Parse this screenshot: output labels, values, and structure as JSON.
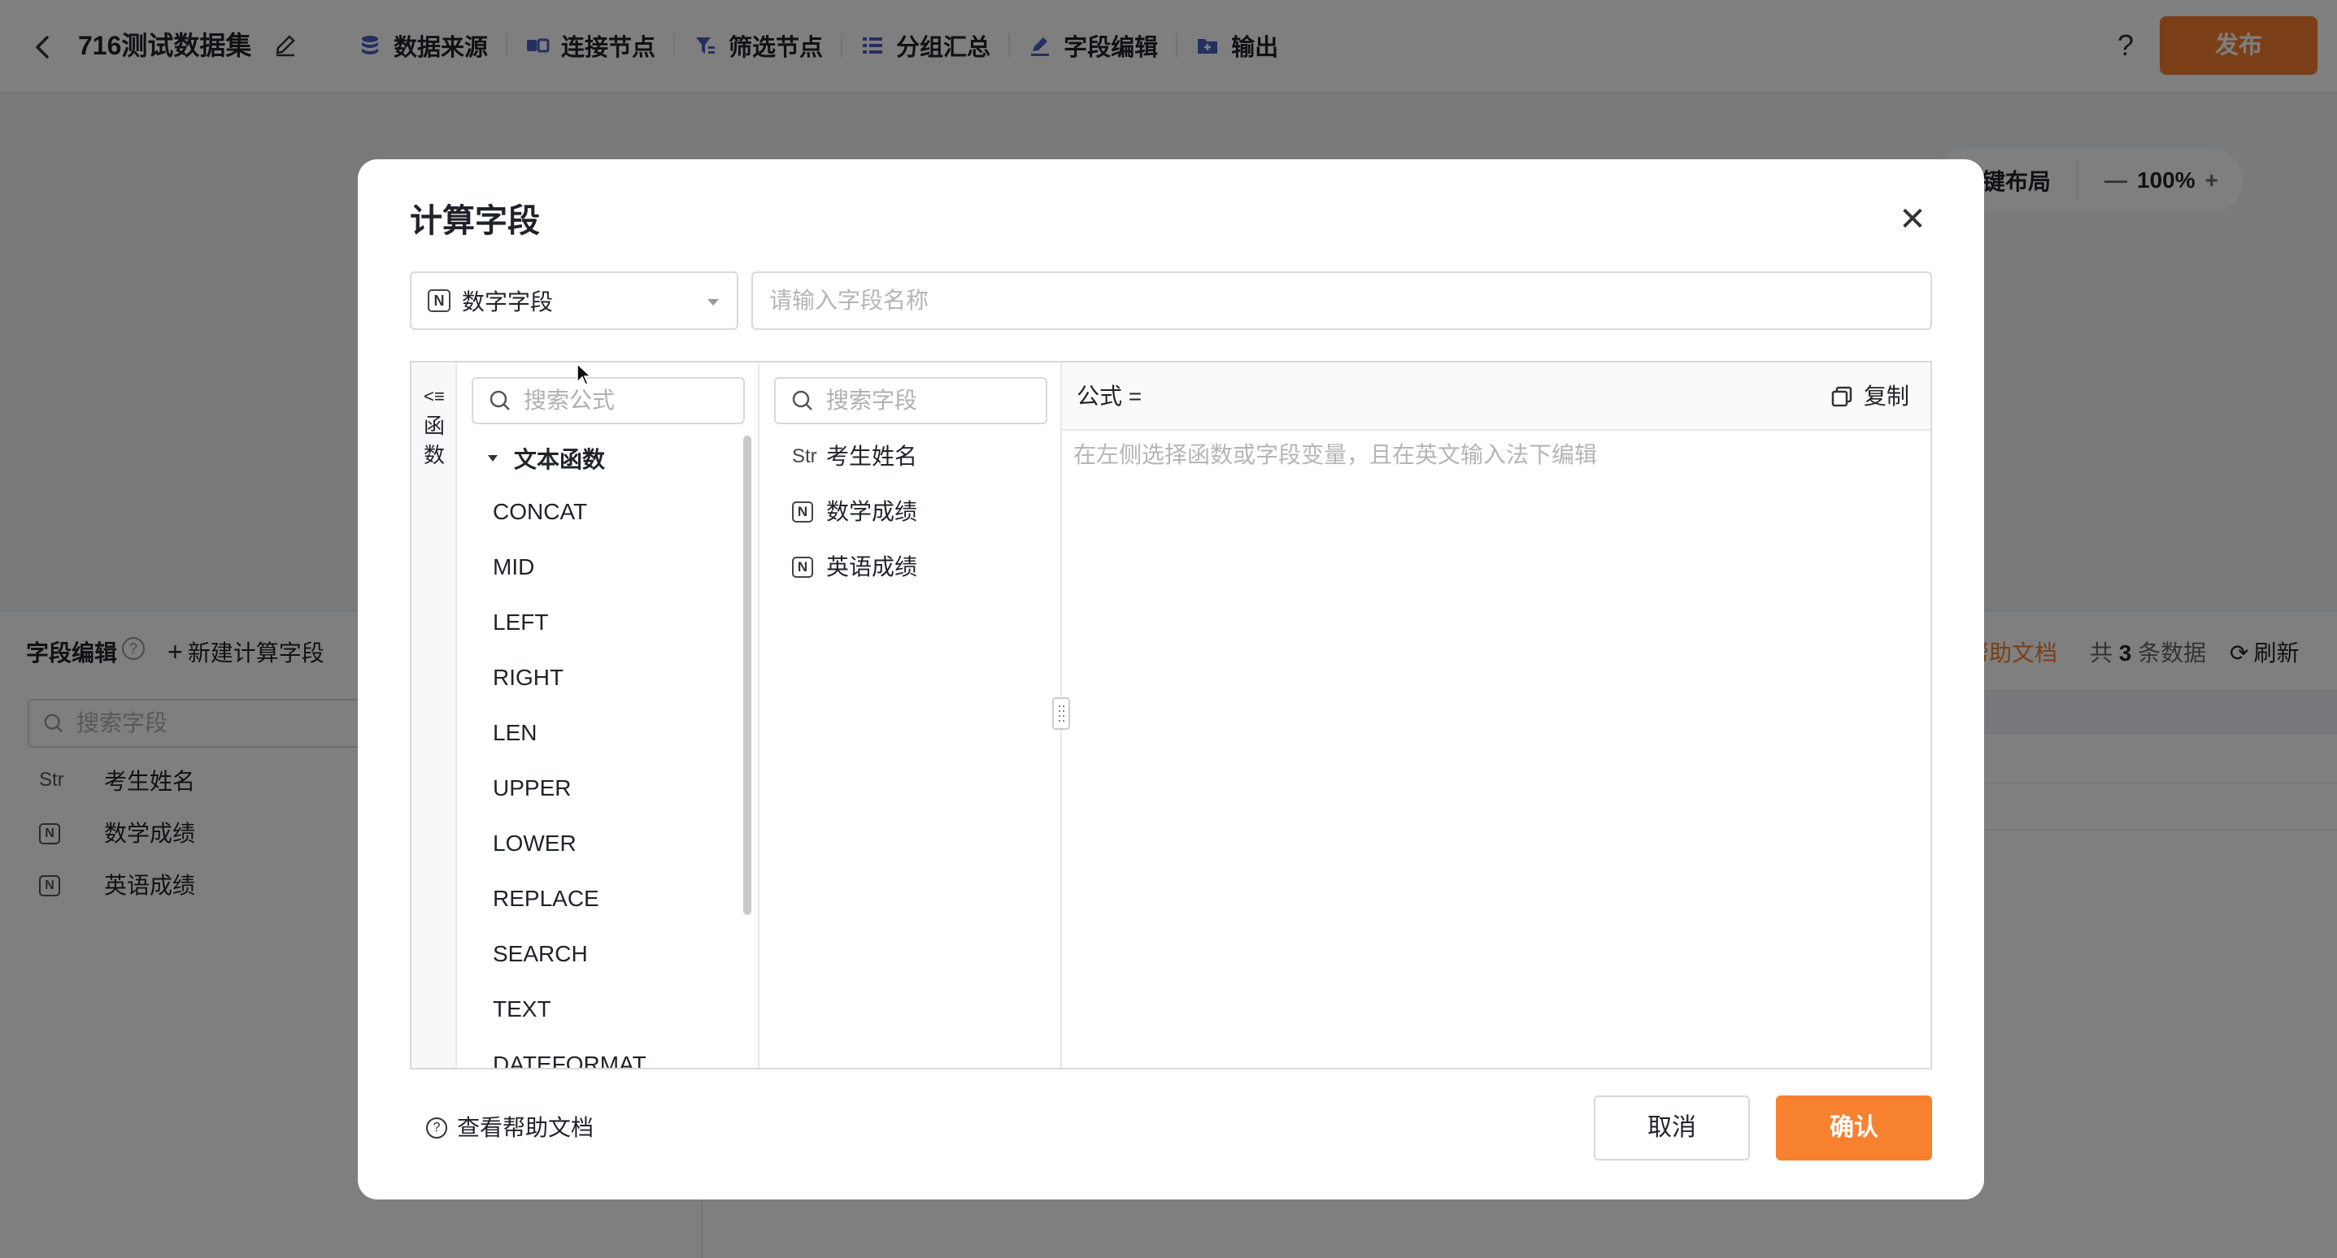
{
  "topbar": {
    "title": "716测试数据集",
    "steps": [
      {
        "label": "数据来源",
        "icon": "database-icon"
      },
      {
        "label": "连接节点",
        "icon": "join-icon"
      },
      {
        "label": "筛选节点",
        "icon": "filter-icon"
      },
      {
        "label": "分组汇总",
        "icon": "group-icon"
      },
      {
        "label": "字段编辑",
        "icon": "pen-icon"
      },
      {
        "label": "输出",
        "icon": "output-icon"
      }
    ],
    "help": "?",
    "publish_label": "发布"
  },
  "canvas": {
    "auto_layout_label": "一键布局",
    "zoom": "100%",
    "zoom_out": "—",
    "zoom_in": "+"
  },
  "bottom_panel": {
    "title": "字段编辑",
    "new_field_label": "新建计算字段",
    "search_placeholder": "搜索字段",
    "fields": [
      {
        "type": "Str",
        "name": "考生姓名"
      },
      {
        "type": "N",
        "name": "数学成绩"
      },
      {
        "type": "N",
        "name": "英语成绩"
      }
    ],
    "help_doc_label": "帮助文档",
    "count_prefix": "共",
    "count_value": "3",
    "count_suffix": "条数据",
    "refresh_label": "刷新"
  },
  "modal": {
    "title": "计算字段",
    "type_select_value": "数字字段",
    "type_select_tag": "N",
    "name_placeholder": "请输入字段名称",
    "fn_toggle_label": "<≡ 函数",
    "fn_search_placeholder": "搜索公式",
    "fn_group_label": "文本函数",
    "functions": [
      "CONCAT",
      "MID",
      "LEFT",
      "RIGHT",
      "LEN",
      "UPPER",
      "LOWER",
      "REPLACE",
      "SEARCH",
      "TEXT",
      "DATEFORMAT"
    ],
    "field_search_placeholder": "搜索字段",
    "fields": [
      {
        "type": "Str",
        "name": "考生姓名"
      },
      {
        "type": "N",
        "name": "数学成绩"
      },
      {
        "type": "N",
        "name": "英语成绩"
      }
    ],
    "formula_label": "公式 =",
    "copy_label": "复制",
    "formula_placeholder": "在左侧选择函数或字段变量，且在英文输入法下编辑",
    "help_doc_label": "查看帮助文档",
    "cancel_label": "取消",
    "confirm_label": "确认"
  },
  "colors": {
    "accent": "#f77f2e",
    "overlay": "rgba(0,0,0,0.5)"
  }
}
